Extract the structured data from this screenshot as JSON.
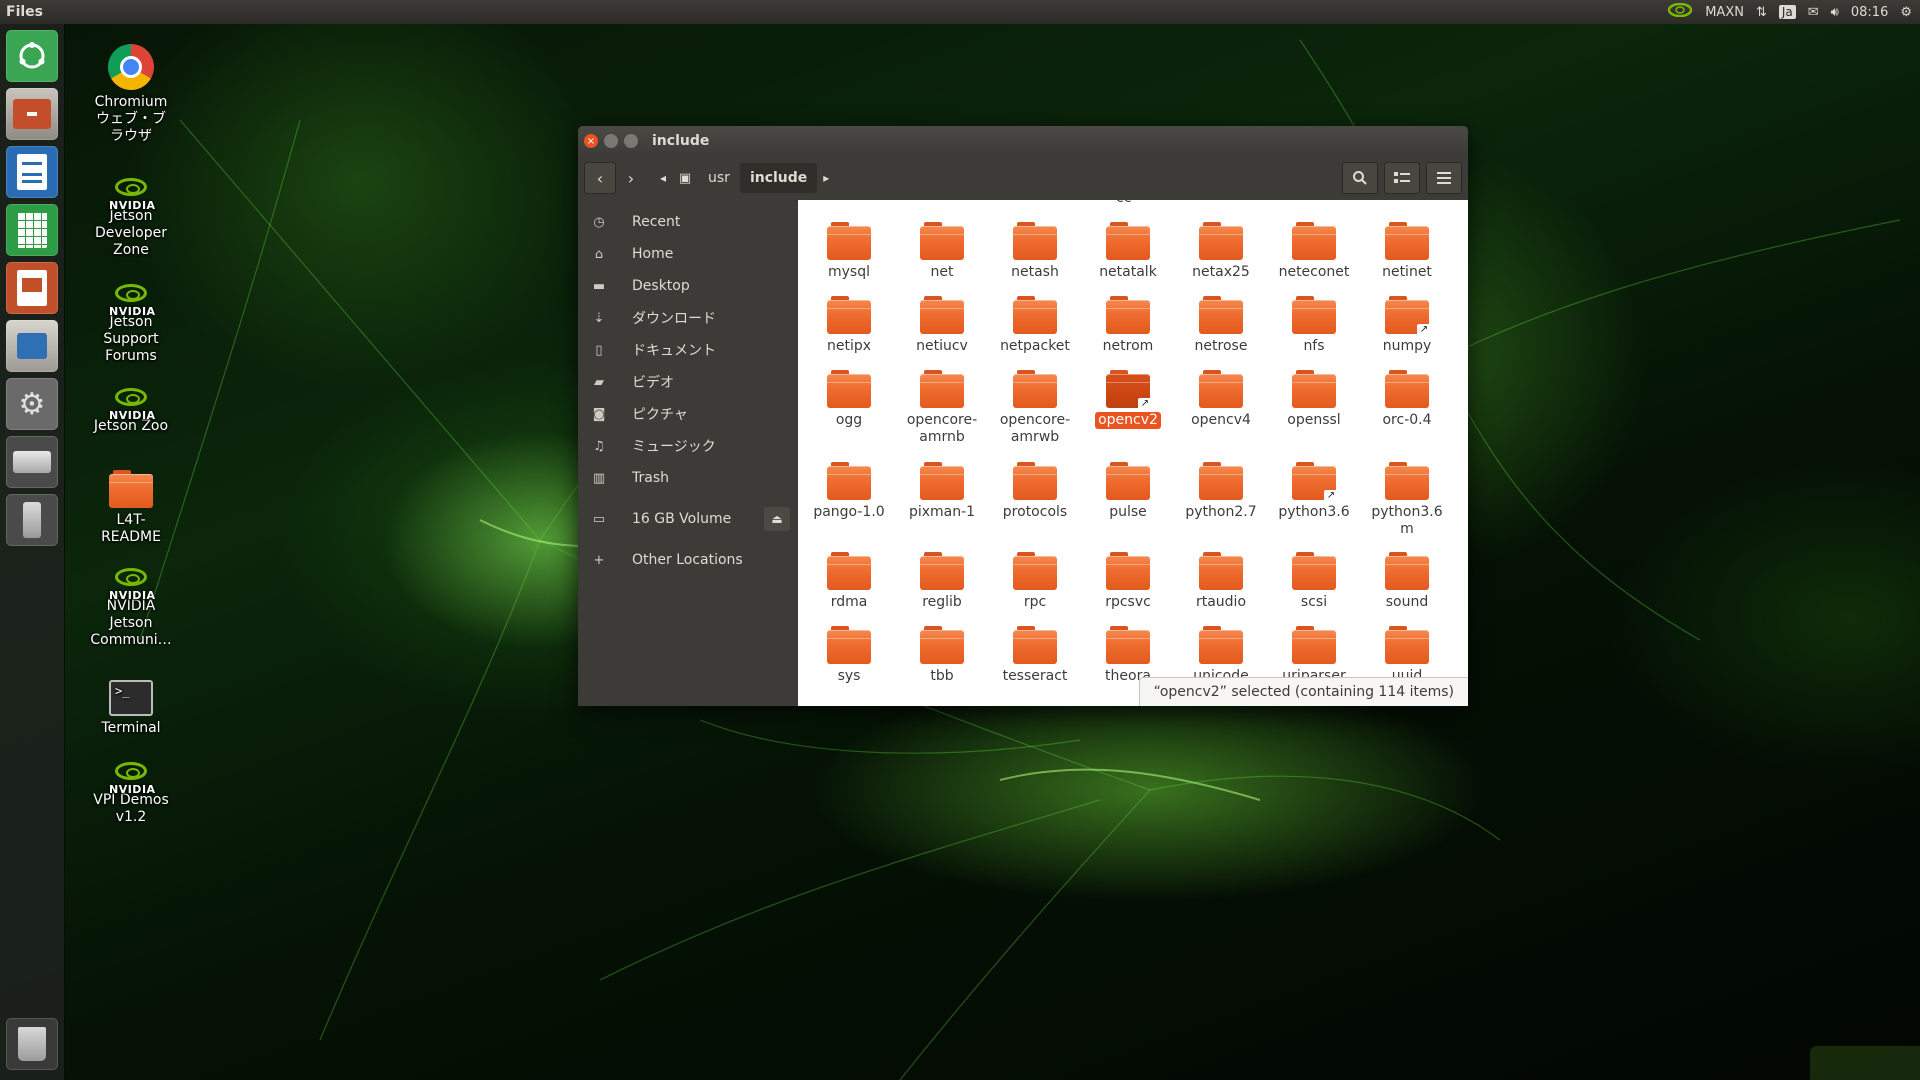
{
  "top_panel": {
    "app_title": "Files",
    "power_mode": "MAXN",
    "keyboard_layout": "Ja",
    "clock": "08:16"
  },
  "launcher": {
    "items": [
      {
        "name": "ubuntu-dash-icon",
        "color": "#3aa552"
      },
      {
        "name": "files-icon",
        "color": "#c44e2b"
      },
      {
        "name": "writer-icon",
        "color": "#2a6db5"
      },
      {
        "name": "calc-icon",
        "color": "#2d9c45"
      },
      {
        "name": "impress-icon",
        "color": "#c1502a"
      },
      {
        "name": "software-center-icon",
        "color": "#2f6fb3"
      },
      {
        "name": "system-settings-icon",
        "color": "#8a8a8a"
      },
      {
        "name": "disk-drive-icon",
        "color": "#9a9a9a"
      },
      {
        "name": "usb-drive-icon",
        "color": "#8c8c8c"
      },
      {
        "name": "trash-icon",
        "color": "#9e9e9e"
      }
    ]
  },
  "desktop": {
    "icons": [
      {
        "label": "Chromium\nウェブ・ブラウザ",
        "line1": "Chromium",
        "line2": "ウェブ・ブ",
        "line3": "ラウザ"
      },
      {
        "line1": "Jetson",
        "line2": "Developer",
        "line3": "Zone"
      },
      {
        "line1": "Jetson",
        "line2": "Support",
        "line3": "Forums"
      },
      {
        "line1": "Jetson Zoo"
      },
      {
        "line1": "L4T-",
        "line2": "README"
      },
      {
        "line1": "NVIDIA",
        "line2": "Jetson",
        "line3": "Communi…"
      },
      {
        "line1": "Terminal"
      },
      {
        "line1": "VPI Demos",
        "line2": "v1.2"
      }
    ],
    "nvidia_logo_text": "NVIDIA"
  },
  "window": {
    "title": "include",
    "breadcrumbs": [
      "usr",
      "include"
    ],
    "sidebar": {
      "items": [
        {
          "label": "Recent"
        },
        {
          "label": "Home"
        },
        {
          "label": "Desktop"
        },
        {
          "label": "ダウンロード"
        },
        {
          "label": "ドキュメント"
        },
        {
          "label": "ビデオ"
        },
        {
          "label": "ピクチャ"
        },
        {
          "label": "ミュージック"
        },
        {
          "label": "Trash"
        },
        {
          "label": "16 GB Volume"
        },
        {
          "label": "Other Locations"
        }
      ]
    },
    "partial_top_label": "cc",
    "folders": [
      {
        "name": "mysql"
      },
      {
        "name": "net"
      },
      {
        "name": "netash"
      },
      {
        "name": "netatalk"
      },
      {
        "name": "netax25"
      },
      {
        "name": "neteconet"
      },
      {
        "name": "netinet"
      },
      {
        "name": "netipx"
      },
      {
        "name": "netiucv"
      },
      {
        "name": "netpacket"
      },
      {
        "name": "netrom"
      },
      {
        "name": "netrose"
      },
      {
        "name": "nfs"
      },
      {
        "name": "numpy",
        "link": true
      },
      {
        "name": "ogg"
      },
      {
        "name": "opencore-amrnb",
        "line1": "opencore-",
        "line2": "amrnb"
      },
      {
        "name": "opencore-amrwb",
        "line1": "opencore-",
        "line2": "amrwb"
      },
      {
        "name": "opencv2",
        "link": true,
        "selected": true
      },
      {
        "name": "opencv4"
      },
      {
        "name": "openssl"
      },
      {
        "name": "orc-0.4"
      },
      {
        "name": "pango-1.0"
      },
      {
        "name": "pixman-1"
      },
      {
        "name": "protocols"
      },
      {
        "name": "pulse"
      },
      {
        "name": "python2.7"
      },
      {
        "name": "python3.6",
        "link": true
      },
      {
        "name": "python3.6m",
        "line1": "python3.6",
        "line2": "m"
      },
      {
        "name": "rdma"
      },
      {
        "name": "reglib"
      },
      {
        "name": "rpc"
      },
      {
        "name": "rpcsvc"
      },
      {
        "name": "rtaudio"
      },
      {
        "name": "scsi"
      },
      {
        "name": "sound"
      },
      {
        "name": "sys"
      },
      {
        "name": "tbb"
      },
      {
        "name": "tesseract"
      },
      {
        "name": "theora"
      },
      {
        "name": "unicode"
      },
      {
        "name": "uriparser"
      },
      {
        "name": "uuid"
      }
    ],
    "status_text": "“opencv2” selected  (containing 114 items)"
  },
  "colors": {
    "accent": "#e95420",
    "folder": "#ef6b2e",
    "nvidia_green": "#76b900"
  }
}
